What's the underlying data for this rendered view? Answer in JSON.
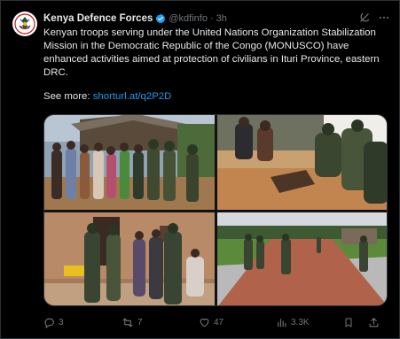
{
  "tweet": {
    "author_name": "Kenya Defence Forces",
    "handle": "@kdfinfo",
    "separator": "·",
    "time": "3h",
    "body": "Kenyan troops serving under the United Nations Organization Stabilization Mission in the Democratic Republic of the Congo (MONUSCO) have enhanced activities aimed at protection of civilians in Ituri Province, eastern DRC.",
    "see_more_label": "See more: ",
    "see_more_link": "shorturl.at/q2P2D"
  },
  "actions": {
    "replies": "3",
    "reposts": "7",
    "likes": "47",
    "views": "3.3K"
  },
  "icons": {
    "verified": "verified-badge-icon",
    "grok": "grok-icon",
    "more": "more-icon",
    "reply": "reply-icon",
    "repost": "repost-icon",
    "like": "like-icon",
    "views": "views-icon",
    "bookmark": "bookmark-icon",
    "share": "share-icon"
  },
  "colors": {
    "background": "#000000",
    "text": "#e7e9ea",
    "muted": "#71767b",
    "link": "#1d9bf0",
    "verified": "#1d9bf0",
    "border": "#2f3336"
  }
}
